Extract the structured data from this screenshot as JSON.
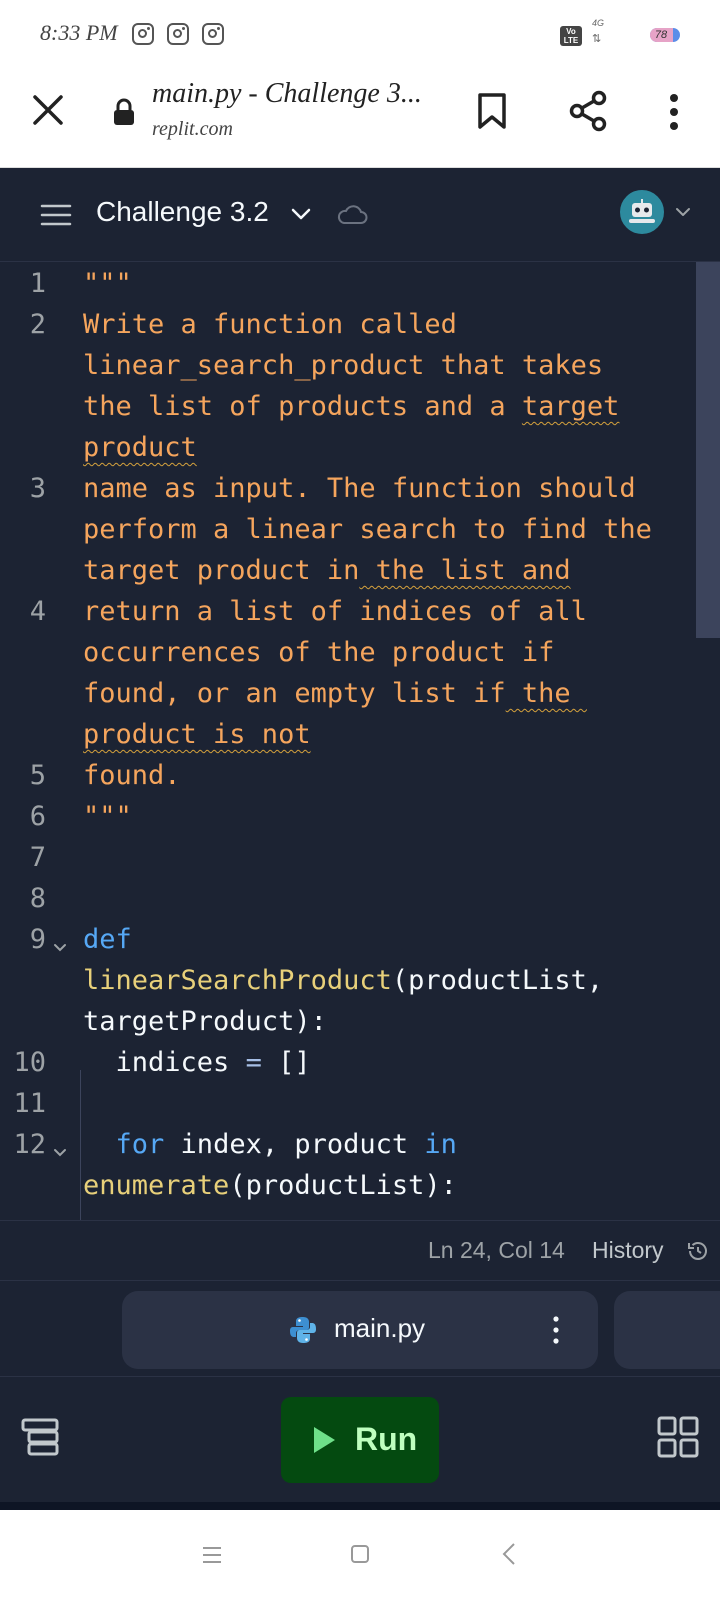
{
  "status_bar": {
    "time": "8:33 PM",
    "volte": "Vo LTE",
    "network": "4G",
    "battery": "78",
    "battery_level": 0.78
  },
  "browser": {
    "page_title": "main.py - Challenge 3...",
    "url": "replit.com"
  },
  "replit_header": {
    "repl_name": "Challenge 3.2"
  },
  "editor": {
    "line_numbers": [
      "1",
      "2",
      "3",
      "4",
      "5",
      "6",
      "7",
      "8",
      "9",
      "10",
      "11",
      "12"
    ],
    "doc_lines": {
      "l1": "\"\"\"",
      "l2a": "Write a function called",
      "l2b": "linear_search_product that takes",
      "l2c_pre": "the list of products and a ",
      "l2c_sq": "target",
      "l2d": "product",
      "l3a": "name as input. The function should",
      "l3b": "perform a linear search to find the",
      "l3c_pre": "target product in",
      "l3c_sq": " the list and",
      "l4a": "return a list of indices of all",
      "l4b": "occurrences of the product if",
      "l4c_pre": "found, or an empty list if",
      "l4c_sq": " the ",
      "l4d": "product is not",
      "l5": "found.",
      "l6": "\"\"\""
    },
    "code": {
      "def_kw": "def",
      "fn_name": "linearSearchProduct",
      "params_a": "(productList,",
      "params_b": "targetProduct):",
      "indices_var": "indices",
      "assign_op": " = ",
      "empty_list": "[]",
      "for_kw": "for",
      "loop_vars": " index, product ",
      "in_kw": "in",
      "enumerate_fn": "enumerate",
      "enumerate_args": "(productList):"
    }
  },
  "status_line": {
    "cursor_position": "Ln 24, Col 14",
    "history_label": "History"
  },
  "tabs": [
    {
      "label": "main.py"
    }
  ],
  "toolbar": {
    "run_label": "Run"
  },
  "colors": {
    "editor_bg": "#1c2333",
    "docstring": "#f5a55d",
    "keyword": "#56a8f5",
    "function": "#e8d07a",
    "run_button_bg": "#044a10",
    "run_button_text": "#bfffbf"
  },
  "icons": {
    "browser": [
      "close-icon",
      "lock-icon",
      "bookmark-icon",
      "share-icon",
      "more-vert-icon"
    ],
    "header": [
      "hamburger-menu-icon",
      "chevron-down-icon",
      "cloud-icon",
      "avatar"
    ],
    "status": [
      "history-icon"
    ],
    "tab": [
      "python-icon",
      "more-vert-icon"
    ],
    "toolbar": [
      "stack-icon",
      "play-icon",
      "grid-icon"
    ],
    "nav": [
      "nav-recents-icon",
      "nav-home-icon",
      "nav-back-icon"
    ]
  }
}
